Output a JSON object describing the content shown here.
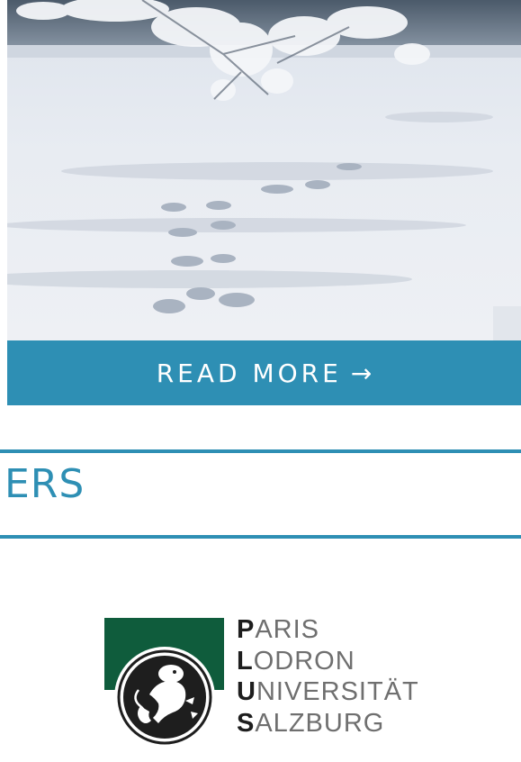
{
  "card": {
    "image_alt": "Animal tracks in snow under frosted pine branches",
    "read_more_label": "READ MORE",
    "read_more_arrow": "→"
  },
  "section": {
    "title": "ERS"
  },
  "logo": {
    "lines": [
      {
        "initial": "P",
        "rest": "ARIS"
      },
      {
        "initial": "L",
        "rest": "ODRON"
      },
      {
        "initial": "U",
        "rest": "NIVERSITÄT"
      },
      {
        "initial": "S",
        "rest": "ALZBURG"
      }
    ],
    "colors": {
      "green": "#0f5c3c",
      "dark": "#1e1e1e",
      "gray": "#6f6f6f"
    }
  },
  "colors": {
    "accent": "#2e8fb4"
  }
}
